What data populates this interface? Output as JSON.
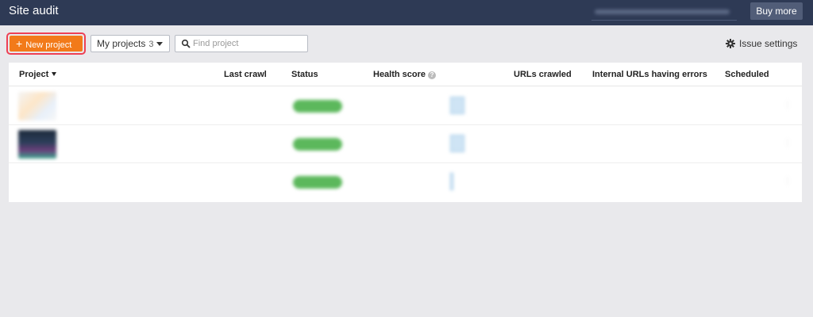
{
  "topbar": {
    "title": "Site audit",
    "account_blurred": "",
    "buy_more_label": "Buy more"
  },
  "toolbar": {
    "new_project_label": "New project",
    "my_projects_label": "My projects",
    "my_projects_count": "3",
    "search_placeholder": "Find project",
    "issue_settings_label": "Issue settings"
  },
  "table": {
    "headers": {
      "project": "Project",
      "last_crawl": "Last crawl",
      "status": "Status",
      "health_score": "Health score",
      "urls_crawled": "URLs crawled",
      "internal_errors": "Internal URLs having errors",
      "scheduled": "Scheduled"
    },
    "rows": [
      {
        "name": "",
        "url": "",
        "crawl_date": "",
        "crawl_time": "",
        "status": "",
        "health": "",
        "health_unit": "",
        "health_delta": "",
        "urls_crawled": "",
        "errors": "",
        "errors_delta": "",
        "sched_a": "",
        "sched_b": ""
      },
      {
        "name": "",
        "url": "",
        "crawl_date": "",
        "crawl_time": "",
        "status": "",
        "health": "",
        "health_unit": "",
        "health_delta": "",
        "urls_crawled": "",
        "errors": "",
        "errors_delta": "",
        "sched_a": "",
        "sched_b": ""
      },
      {
        "name": "",
        "url": "",
        "crawl_date": "",
        "crawl_time": "",
        "status": "",
        "health": "",
        "health_unit": "",
        "health_delta": "",
        "urls_crawled": "",
        "errors": "",
        "errors_delta": "",
        "sched_a": "",
        "sched_b": ""
      }
    ]
  },
  "colors": {
    "topbar_bg": "#2e3a55",
    "accent_orange": "#f27a1a",
    "highlight_red": "#ee4054",
    "status_green": "#5cb85c",
    "link_blue": "#2b6cd6"
  },
  "icons": [
    "plus-icon",
    "chevron-down-icon",
    "search-icon",
    "gear-icon",
    "help-icon",
    "sort-caret-icon",
    "more-icon"
  ]
}
